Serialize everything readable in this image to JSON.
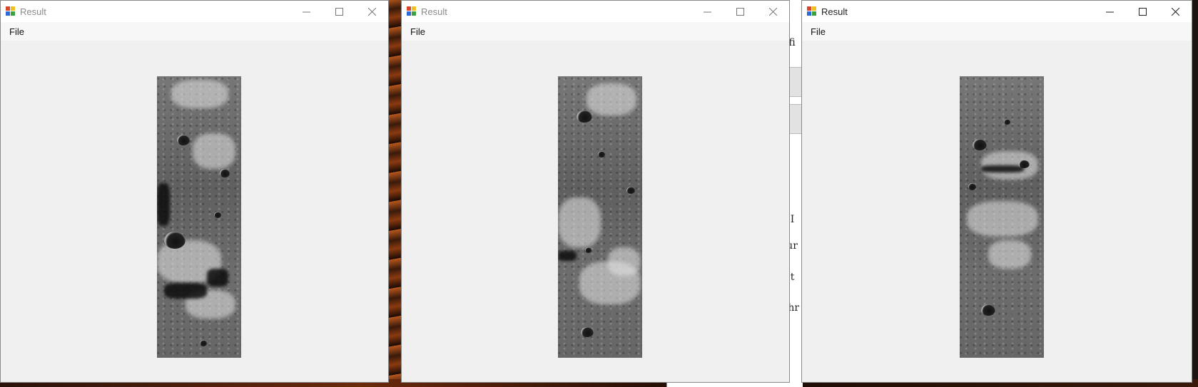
{
  "background_document": {
    "fragments": [
      "afi",
      "e I",
      "sur",
      "e t",
      "Thr"
    ]
  },
  "windows": [
    {
      "title": "Result",
      "active": false,
      "menu": [
        {
          "label": "File"
        }
      ],
      "controls": {
        "minimize": "minimize-icon",
        "maximize": "maximize-icon",
        "close": "close-icon"
      }
    },
    {
      "title": "Result",
      "active": false,
      "menu": [
        {
          "label": "File"
        }
      ],
      "controls": {
        "minimize": "minimize-icon",
        "maximize": "maximize-icon",
        "close": "close-icon"
      }
    },
    {
      "title": "Result",
      "active": true,
      "menu": [
        {
          "label": "File"
        }
      ],
      "controls": {
        "minimize": "minimize-icon",
        "maximize": "maximize-icon",
        "close": "close-icon"
      }
    }
  ]
}
